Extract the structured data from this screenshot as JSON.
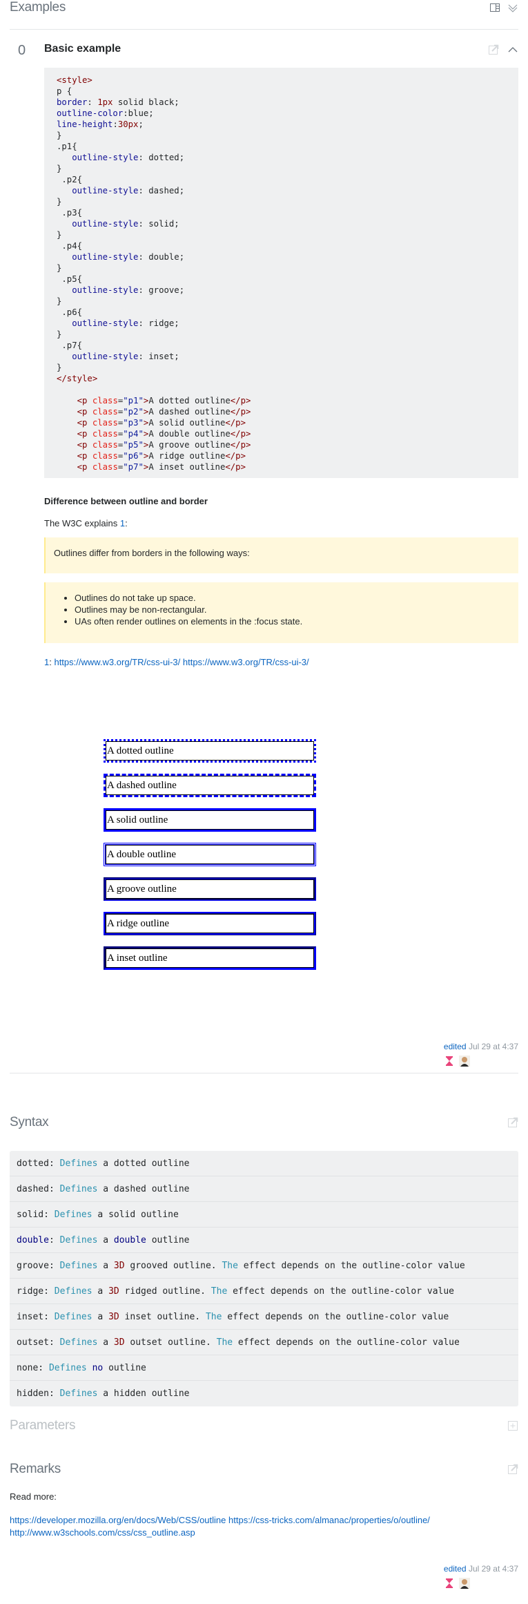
{
  "examples": {
    "title": "Examples",
    "icons": [
      "layout-panel-icon",
      "double-chevron-down-icon"
    ],
    "example": {
      "index": "0",
      "title": "Basic example",
      "code_lines": [
        "<style>",
        "p {",
        "border: 1px solid black;",
        "outline-color:blue;",
        "line-height:30px;",
        "}",
        ".p1{",
        "   outline-style: dotted;",
        "}",
        " .p2{",
        "   outline-style: dashed;",
        "}",
        " .p3{",
        "   outline-style: solid;",
        "}",
        " .p4{",
        "   outline-style: double;",
        "}",
        " .p5{",
        "   outline-style: groove;",
        "}",
        " .p6{",
        "   outline-style: ridge;",
        "}",
        " .p7{",
        "   outline-style: inset;",
        "}",
        "</style>",
        "",
        "    <p class=\"p1\">A dotted outline</p>",
        "    <p class=\"p2\">A dashed outline</p>",
        "    <p class=\"p3\">A solid outline</p>",
        "    <p class=\"p4\">A double outline</p>",
        "    <p class=\"p5\">A groove outline</p>",
        "    <p class=\"p6\">A ridge outline</p>",
        "    <p class=\"p7\">A inset outline</p>"
      ],
      "diff_heading": "Difference between outline and border",
      "w3c_prefix": "The W3C explains ",
      "w3c_ref": "1",
      "w3c_suffix": ":",
      "quote_intro": "Outlines differ from borders in the following ways:",
      "quote_items": [
        "Outlines do not take up space.",
        "Outlines may be non-rectangular.",
        "UAs often render outlines on elements in the :focus state."
      ],
      "footnote_ref": "1",
      "footnote_sep": ": ",
      "footnote_links": [
        "https://www.w3.org/TR/css-ui-3/",
        "https://www.w3.org/TR/css-ui-3/"
      ],
      "demo_items": [
        {
          "text": "A dotted outline",
          "style": "dotted"
        },
        {
          "text": "A dashed outline",
          "style": "dashed"
        },
        {
          "text": "A solid outline",
          "style": "solid"
        },
        {
          "text": "A double outline",
          "style": "double"
        },
        {
          "text": "A groove outline",
          "style": "groove"
        },
        {
          "text": "A ridge outline",
          "style": "ridge"
        },
        {
          "text": "A inset outline",
          "style": "inset"
        }
      ],
      "edited_label": "edited",
      "edited_time": " Jul 29 at 4:37"
    }
  },
  "syntax": {
    "title": "Syntax",
    "rows": [
      [
        {
          "t": "dotted: "
        },
        {
          "t": "Defines",
          "c": "kw"
        },
        {
          "t": " a dotted outline"
        }
      ],
      [
        {
          "t": "dashed: "
        },
        {
          "t": "Defines",
          "c": "kw"
        },
        {
          "t": " a dashed outline"
        }
      ],
      [
        {
          "t": "solid: "
        },
        {
          "t": "Defines",
          "c": "kw"
        },
        {
          "t": " a solid outline"
        }
      ],
      [
        {
          "t": "double",
          "c": "kw2"
        },
        {
          "t": ": "
        },
        {
          "t": "Defines",
          "c": "kw"
        },
        {
          "t": " a "
        },
        {
          "t": "double",
          "c": "kw2"
        },
        {
          "t": " outline"
        }
      ],
      [
        {
          "t": "groove: "
        },
        {
          "t": "Defines",
          "c": "kw"
        },
        {
          "t": " a "
        },
        {
          "t": "3D",
          "c": "kw3"
        },
        {
          "t": " grooved outline. "
        },
        {
          "t": "The",
          "c": "kw"
        },
        {
          "t": " effect depends on the outline-color value"
        }
      ],
      [
        {
          "t": "ridge: "
        },
        {
          "t": "Defines",
          "c": "kw"
        },
        {
          "t": " a "
        },
        {
          "t": "3D",
          "c": "kw3"
        },
        {
          "t": " ridged outline. "
        },
        {
          "t": "The",
          "c": "kw"
        },
        {
          "t": " effect depends on the outline-color value"
        }
      ],
      [
        {
          "t": "inset: "
        },
        {
          "t": "Defines",
          "c": "kw"
        },
        {
          "t": " a "
        },
        {
          "t": "3D",
          "c": "kw3"
        },
        {
          "t": " inset outline. "
        },
        {
          "t": "The",
          "c": "kw"
        },
        {
          "t": " effect depends on the outline-color value"
        }
      ],
      [
        {
          "t": "outset: "
        },
        {
          "t": "Defines",
          "c": "kw"
        },
        {
          "t": " a "
        },
        {
          "t": "3D",
          "c": "kw3"
        },
        {
          "t": " outset outline. "
        },
        {
          "t": "The",
          "c": "kw"
        },
        {
          "t": " effect depends on the outline-color value"
        }
      ],
      [
        {
          "t": "none: "
        },
        {
          "t": "Defines",
          "c": "kw"
        },
        {
          "t": " "
        },
        {
          "t": "no",
          "c": "kw2"
        },
        {
          "t": " outline"
        }
      ],
      [
        {
          "t": "hidden: "
        },
        {
          "t": "Defines",
          "c": "kw"
        },
        {
          "t": " a hidden outline"
        }
      ]
    ]
  },
  "parameters": {
    "title": "Parameters"
  },
  "remarks": {
    "title": "Remarks",
    "read_more": "Read more:",
    "links": [
      "https://developer.mozilla.org/en/docs/Web/CSS/outline",
      "https://css-tricks.com/almanac/properties/o/outline/",
      "http://www.w3schools.com/css/css_outline.asp"
    ],
    "edited_label": "edited",
    "edited_time": " Jul 29 at 4:37"
  },
  "colors": {
    "link": "#0c65c0",
    "quote_bg": "#fff8dc",
    "code_bg": "#eff0f1",
    "outline_blue": "#0000ff"
  }
}
